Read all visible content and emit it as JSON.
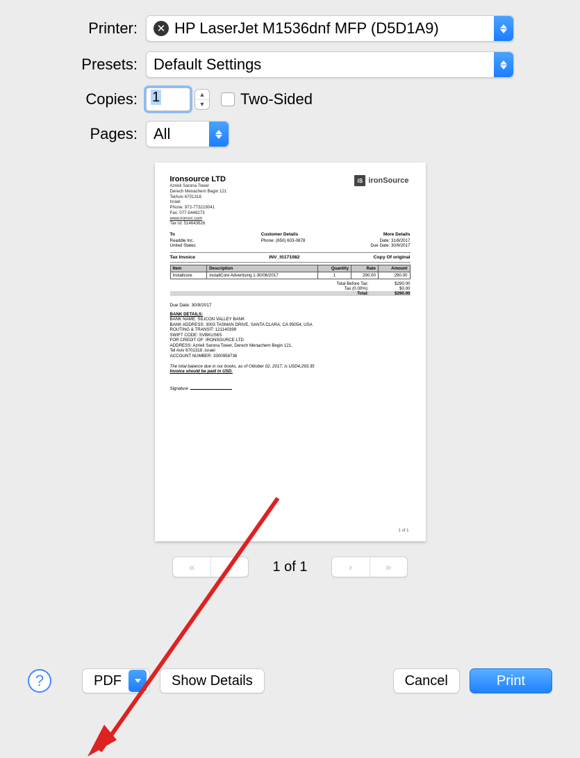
{
  "header": {
    "printer_label": "Printer:",
    "printer_value": "HP LaserJet M1536dnf MFP (D5D1A9)",
    "printer_status_icon": "offline",
    "presets_label": "Presets:",
    "presets_value": "Default Settings",
    "copies_label": "Copies:",
    "copies_value": "1",
    "two_sided_label": "Two-Sided",
    "pages_label": "Pages:",
    "pages_value": "All"
  },
  "nav": {
    "page_indicator": "1 of 1"
  },
  "buttons": {
    "pdf": "PDF",
    "show_details": "Show Details",
    "cancel": "Cancel",
    "print": "Print"
  },
  "preview": {
    "company_name": "Ironsource LTD",
    "company_lines": [
      "Azrieli Sarona Tower",
      "Derech Menachem Begin 121",
      "TelAviv 6701318",
      "Israel",
      "Phone: 972-773219041",
      "Fax: 077-5448273"
    ],
    "company_link": "www.ironsrc.com",
    "tax_id": "Tax Id: 514643626",
    "logo_mark": "iS",
    "logo_text": "ironSource",
    "to_title": "To",
    "to_lines": [
      "Readdle Inc.",
      "United States"
    ],
    "cust_title": "Customer Details",
    "cust_line": "Phone: (650) 603-0878",
    "more_title": "More Details",
    "more_date": "Date: 31/8/2017",
    "more_due": "Due Date: 30/9/2017",
    "inv_label": "Tax Invoice",
    "inv_no": "INV_IS171082",
    "copy": "Copy Of original",
    "cols": {
      "item": "Item",
      "desc": "Description",
      "qty": "Quantity",
      "rate": "Rate",
      "amt": "Amount"
    },
    "row": {
      "item": "Installcore",
      "desc": "installCore Advertising 1-30/06/2017",
      "qty": "1",
      "rate": "290.00",
      "amt": "290.00"
    },
    "totals": {
      "before_tax_label": "Total Before Tax:",
      "before_tax_val": "$290.00",
      "tax_label": "Tax (0.00%):",
      "tax_val": "$0.00",
      "grand_label": "Total:",
      "grand_val": "$290.00"
    },
    "due_line": "Due Date: 30/9/2017",
    "bank_title": "BANK DETAILS:",
    "bank_lines": [
      "BANK NAME: SILICON VALLEY BANK",
      "BANK ADDRESS: 3003 TASMAN DRIVE, SANTA CLARA, CA 95054, USA",
      "ROUTING & TRANSIT: 121140399",
      "SWIFT CODE: SVBKUS6S",
      "FOR CREDIT OF: IRONSOURCE LTD",
      "ADDRESS: Azrieli Sarona Tower, Derech Menachem Begin 121,",
      "Tel Aviv 6701318 ,Israel",
      "ACCOUNT NUMBER: 3300958736"
    ],
    "note_line1": "The total balance due in our books, as of Oktober 02, 2017, is USD4,293.35",
    "note_line2": "Invoice should be paid in USD.",
    "signature_label": "Signature",
    "page_num": "1 of 1"
  }
}
